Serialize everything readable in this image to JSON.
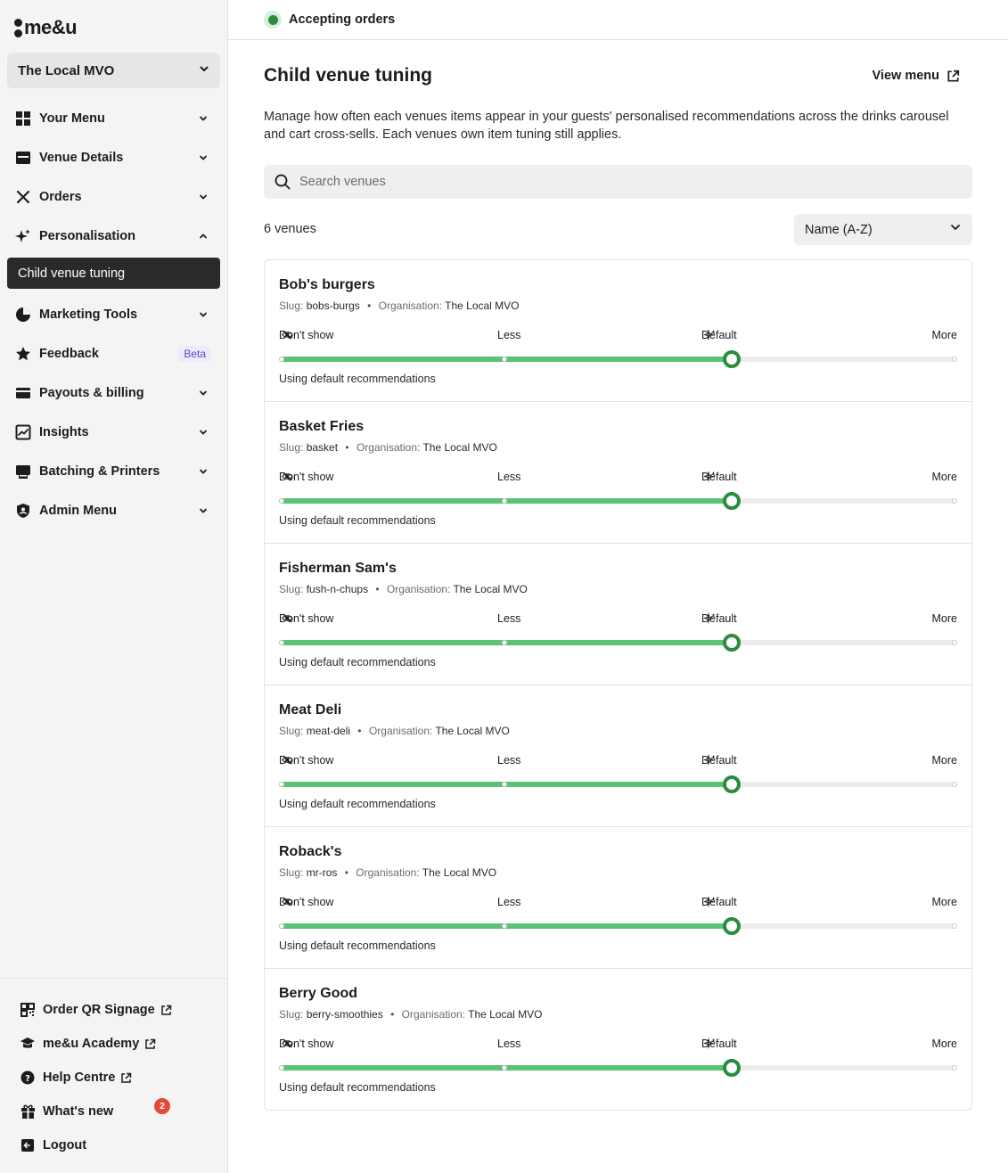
{
  "brand": {
    "logo_text": "me&u"
  },
  "venue_selector": {
    "name": "The Local MVO"
  },
  "nav": {
    "items": [
      {
        "label": "Your Menu"
      },
      {
        "label": "Venue Details"
      },
      {
        "label": "Orders"
      },
      {
        "label": "Personalisation"
      },
      {
        "label": "Child venue tuning"
      },
      {
        "label": "Marketing Tools"
      },
      {
        "label": "Feedback",
        "badge": "Beta"
      },
      {
        "label": "Payouts & billing"
      },
      {
        "label": "Insights"
      },
      {
        "label": "Batching & Printers"
      },
      {
        "label": "Admin Menu"
      }
    ]
  },
  "footer_nav": {
    "items": [
      {
        "label": "Order QR Signage"
      },
      {
        "label": "me&u Academy"
      },
      {
        "label": "Help Centre"
      },
      {
        "label": "What's new",
        "count": "2"
      },
      {
        "label": "Logout"
      }
    ]
  },
  "header": {
    "status": "Accepting orders",
    "status_color": "#2c8c3e"
  },
  "page": {
    "title": "Child venue tuning",
    "view_menu": "View menu",
    "description": "Manage how often each venues items appear in your guests' personalised recommendations across the drinks carousel and cart cross-sells. Each venues own item tuning still applies.",
    "search_placeholder": "Search venues",
    "count": "6 venues",
    "sort": "Name (A-Z)"
  },
  "scale": {
    "labels": [
      "Don't show",
      "Less",
      "Default",
      "More"
    ],
    "slug_label": "Slug:",
    "org_label": "Organisation:",
    "separator": "•"
  },
  "venues": [
    {
      "name": "Bob's burgers",
      "slug": "bobs-burgs",
      "organisation": "The Local MVO",
      "level": "Default",
      "level_fraction": 0.667,
      "hint": "Using default recommendations"
    },
    {
      "name": "Basket Fries",
      "slug": "basket",
      "organisation": "The Local MVO",
      "level": "Default",
      "level_fraction": 0.667,
      "hint": "Using default recommendations"
    },
    {
      "name": "Fisherman Sam's",
      "slug": "fush-n-chups",
      "organisation": "The Local MVO",
      "level": "Default",
      "level_fraction": 0.667,
      "hint": "Using default recommendations"
    },
    {
      "name": "Meat Deli",
      "slug": "meat-deli",
      "organisation": "The Local MVO",
      "level": "Default",
      "level_fraction": 0.667,
      "hint": "Using default recommendations"
    },
    {
      "name": "Roback's",
      "slug": "mr-ros",
      "organisation": "The Local MVO",
      "level": "Default",
      "level_fraction": 0.667,
      "hint": "Using default recommendations"
    },
    {
      "name": "Berry Good",
      "slug": "berry-smoothies",
      "organisation": "The Local MVO",
      "level": "Default",
      "level_fraction": 0.667,
      "hint": "Using default recommendations"
    }
  ],
  "colors": {
    "accent_green": "#2c8c3e",
    "slider_fill": "#5cc274",
    "active_nav": "#2a2a2a",
    "beta_badge": "#5a48c9",
    "notification": "#e5493a"
  }
}
